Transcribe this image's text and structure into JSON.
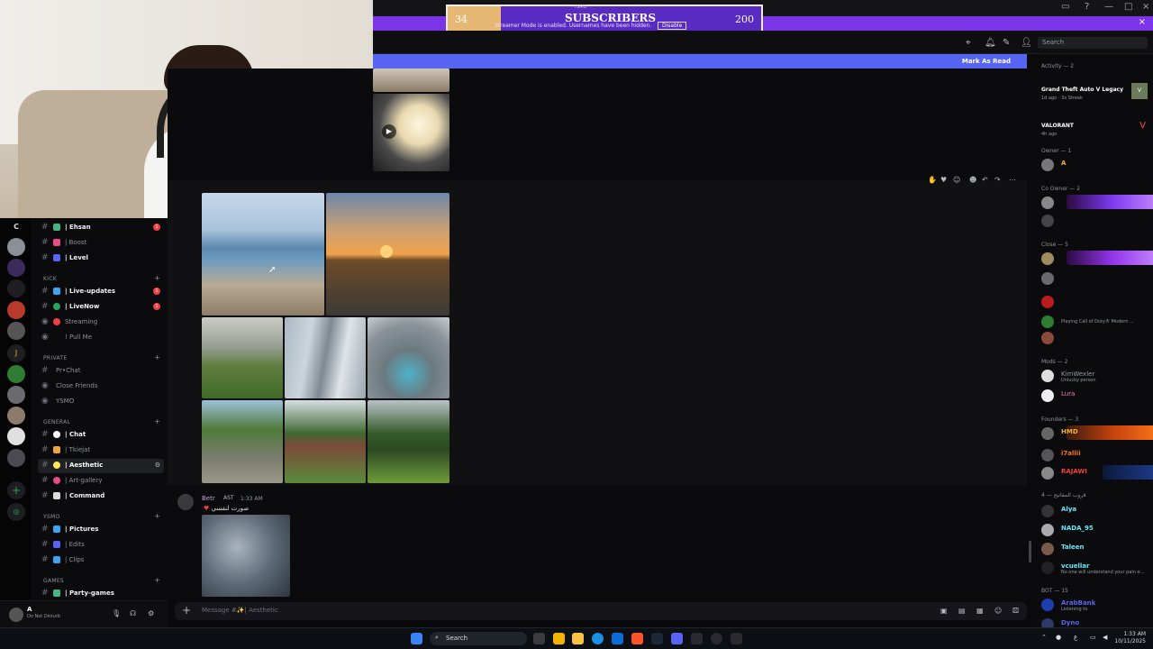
{
  "subscribers": {
    "current": "34",
    "title": "SUBSCRIBERS",
    "goal": "200",
    "progress_fraction": 0.17,
    "notice": "Streamer Mode is enabled. Usernames have been hidden.",
    "disable_label": "Disable",
    "overlay_label": "YSMO"
  },
  "header": {
    "search_placeholder": "Search",
    "mark_as_read": "Mark As Read"
  },
  "sidebar": {
    "server_initial": "C",
    "categories": {
      "kick": "KICK",
      "private": "PRIVATE",
      "general": "GENERAL",
      "ysmo": "YSMO",
      "games": "GAMES"
    },
    "channels": [
      {
        "label": "| Ehsan",
        "bright": true,
        "badge": "1",
        "color": "#43b581"
      },
      {
        "label": "| Boost",
        "bright": false,
        "color": "#ea4c89"
      },
      {
        "label": "| Level",
        "bright": true,
        "color": "#5865f2"
      },
      {
        "label": "| Live-updates",
        "bright": true,
        "badge": "1",
        "color": "#3ba5f2"
      },
      {
        "label": "| LiveNow",
        "bright": true,
        "badge": "1",
        "color": "#23a55a"
      },
      {
        "label": "Streaming",
        "bright": false,
        "color": "#f23f43"
      },
      {
        "label": "! Pull Me",
        "bright": false,
        "color": "#888888"
      },
      {
        "label": "Pr•Chat",
        "bright": false,
        "color": "#888888"
      },
      {
        "label": "Close Friends",
        "bright": false,
        "color": "#888888"
      },
      {
        "label": "YSMO",
        "bright": false,
        "color": "#888888"
      },
      {
        "label": "| Chat",
        "bright": true,
        "color": "#ffffff"
      },
      {
        "label": "| Tkiejat",
        "bright": false,
        "color": "#f2a33a"
      },
      {
        "label": "| Aesthetic",
        "bright": true,
        "selected": true,
        "color": "#fee75c"
      },
      {
        "label": "| Art-gallery",
        "bright": false,
        "color": "#ea4c89"
      },
      {
        "label": "| Command",
        "bright": true,
        "color": "#dddddd"
      },
      {
        "label": "| Pictures",
        "bright": true,
        "color": "#3ba5f2"
      },
      {
        "label": "| Edits",
        "bright": false,
        "color": "#5865f2"
      },
      {
        "label": "| Clips",
        "bright": false,
        "color": "#3ba5f2"
      },
      {
        "label": "| Party-games",
        "bright": true,
        "color": "#43b581"
      }
    ]
  },
  "user": {
    "name": "A",
    "status": "Do Not Disturb"
  },
  "message": {
    "author": "Betr",
    "tag": "AST",
    "time": "1:33 AM",
    "text": "صورت لنفسي"
  },
  "composer": {
    "placeholder": "Message #✨| Aesthetic"
  },
  "members": {
    "activity_header": "Activity — 2",
    "activities": [
      {
        "name": "Grand Theft Auto V Legacy",
        "time": "1d ago · 3x Streak"
      },
      {
        "name": "VALORANT",
        "time": "4h ago"
      }
    ],
    "groups": [
      {
        "header": "Owner — 1",
        "rows": [
          {
            "name": "A",
            "color": "#f0b232",
            "sub": ""
          }
        ]
      },
      {
        "header": "Co Owner — 2",
        "rows": [
          {
            "name": "",
            "color": "#d946ef",
            "sub": ""
          },
          {
            "name": "",
            "color": "#d946ef",
            "sub": ""
          }
        ]
      },
      {
        "header": "Close — 5",
        "rows": [
          {
            "name": "",
            "color": "#c084fc",
            "sub": ""
          },
          {
            "name": "",
            "color": "#f23f43",
            "sub": ""
          },
          {
            "name": "",
            "color": "#aaaaaa",
            "sub": ""
          },
          {
            "name": "",
            "color": "#aaaaaa",
            "sub": "Playing Call of Duty® Modern ..."
          },
          {
            "name": "",
            "color": "#aaaaaa",
            "sub": ""
          }
        ]
      },
      {
        "header": "Mods — 2",
        "rows": [
          {
            "name": "KimWexler",
            "color": "#949ba4",
            "sub": "Unlucky person"
          },
          {
            "name": "Lura",
            "color": "#f472b6",
            "sub": ""
          }
        ]
      },
      {
        "header": "Founders — 3",
        "rows": [
          {
            "name": "HMD",
            "color": "#f0b232",
            "sub": ""
          },
          {
            "name": "i7allii",
            "color": "#f97316",
            "sub": ""
          },
          {
            "name": "RAJAWI",
            "color": "#f23f43",
            "sub": ""
          }
        ]
      },
      {
        "header": "4 — قروب المفاتيح",
        "rows": [
          {
            "name": "Alya",
            "color": "#67e8f9",
            "sub": ""
          },
          {
            "name": "NADA_95",
            "color": "#67e8f9",
            "sub": ""
          },
          {
            "name": "Taleen",
            "color": "#67e8f9",
            "sub": ""
          },
          {
            "name": "vcuellar",
            "color": "#67e8f9",
            "sub": "No one will understand your pain e..."
          }
        ]
      },
      {
        "header": "BOT — 15",
        "rows": [
          {
            "name": "ArabBank",
            "color": "#5865f2",
            "sub": "Listening to"
          },
          {
            "name": "Dyno",
            "color": "#5865f2",
            "sub": ""
          }
        ]
      }
    ]
  },
  "taskbar": {
    "search": "Search",
    "time": "1:33 AM",
    "date": "10/11/2025"
  }
}
